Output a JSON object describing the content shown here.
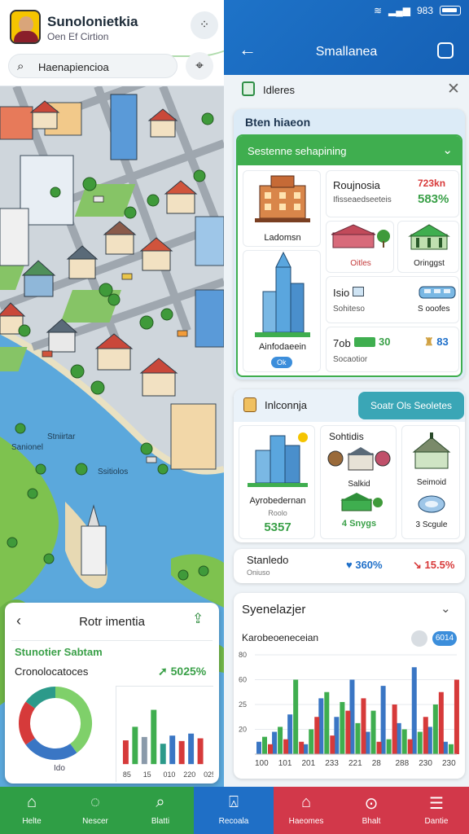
{
  "app": {
    "title": "Sunolonietkia",
    "subtitle": "Oen Ef Cirtion",
    "search_value": "Haenapiencioa"
  },
  "map": {
    "labels": [
      "Sanionel",
      "Stniirtar",
      "Ssitiolos"
    ]
  },
  "map_card": {
    "title": "Rotr imentia",
    "subtitle": "Stunotier Sabtam",
    "metric_label": "Cronolocatoces",
    "metric_value": "5025%",
    "donut_label": "Ido"
  },
  "status_bar": {
    "time": "983"
  },
  "topbar": {
    "title": "Smallanea"
  },
  "info": {
    "title": "Idleres"
  },
  "summary_card": {
    "header": "Bten hiaeon",
    "dropdown": "Sestenne sehapining",
    "tiles": {
      "t1_caption": "Ladomsn",
      "t2_title": "Roujnosia",
      "t2_sub": "Ifisseaedseeteis",
      "t2_val_red": "723kn",
      "t2_val_green": "583%",
      "t3_caption": "Oitles",
      "t4_caption": "Oringgst",
      "t5_caption": "Ainfodaeein",
      "t5_badge": "Ok",
      "t6_title": "Isio",
      "t6_sub": "Sohiteso",
      "t7_caption": "S ooofes",
      "t8_title": "7ob",
      "t8_val_green": "30",
      "t8_sub": "Socaotior",
      "t9_val_blue": "83"
    }
  },
  "info_card": {
    "title": "Inlconnja",
    "pill": "Soatr Ols Seoletes",
    "t1_caption": "Ayrobedernan",
    "t1_sub": "Roolo",
    "t1_value": "5357",
    "t2_title": "Sohtidis",
    "t2_sub": "Salkid",
    "t2_value": "4 Snygs",
    "t3_caption": "Seimoid",
    "t3_sub": "3 Scgule"
  },
  "stat_row": {
    "title": "Stanledo",
    "sub": "Oniuso",
    "up_value": "360%",
    "down_value": "15.5%"
  },
  "chart_card": {
    "title": "Syenelazjer",
    "subtitle": "Karobeoeneceian",
    "badge": "6014"
  },
  "colors": {
    "primary": "#1e73c8",
    "green": "#3fae4f",
    "red": "#d83a3a",
    "teal": "#3aa6b6"
  },
  "nav": [
    {
      "label": "Helte",
      "icon": "home-icon",
      "color": "#2f9e45"
    },
    {
      "label": "Nescer",
      "icon": "chat-icon",
      "color": "#2f9e45"
    },
    {
      "label": "Blatti",
      "icon": "search-icon",
      "color": "#2f9e45"
    },
    {
      "label": "Recoala",
      "icon": "bag-icon",
      "color": "#1f6fc6"
    },
    {
      "label": "Haeomes",
      "icon": "house-icon",
      "color": "#d2384a"
    },
    {
      "label": "Bhalt",
      "icon": "pin-icon",
      "color": "#d2384a"
    },
    {
      "label": "Dantie",
      "icon": "menu-icon",
      "color": "#d2384a"
    }
  ],
  "chart_data": [
    {
      "type": "pie",
      "title": "",
      "slices": [
        {
          "name": "",
          "value": 40,
          "color": "#7fd06a"
        },
        {
          "name": "",
          "value": 25,
          "color": "#3a76c4"
        },
        {
          "name": "",
          "value": 20,
          "color": "#d63a3a"
        },
        {
          "name": "",
          "value": 15,
          "color": "#2c9a8a"
        }
      ]
    },
    {
      "type": "bar",
      "title": "",
      "categories": [
        "85",
        "15",
        "010",
        "220",
        "025"
      ],
      "values": [
        35,
        55,
        40,
        80,
        30,
        42,
        34,
        45,
        38
      ],
      "colors": [
        "#d63a3a",
        "#3fae4f",
        "#8a9aaa",
        "#3fae4f",
        "#2c9a8a",
        "#3a76c4",
        "#d63a3a",
        "#3a76c4",
        "#d63a3a"
      ]
    },
    {
      "type": "bar",
      "title": "",
      "yticks": [
        "20",
        "25",
        "60",
        "80"
      ],
      "categories": [
        "100",
        "101",
        "201",
        "233",
        "221",
        "28",
        "288",
        "230",
        "230"
      ],
      "series": [
        {
          "name": "",
          "color": "#3a76c4",
          "values": [
            10,
            18,
            32,
            8,
            45,
            30,
            60,
            18,
            55,
            25,
            70,
            22,
            10
          ]
        },
        {
          "name": "",
          "color": "#3fae4f",
          "values": [
            14,
            22,
            60,
            20,
            50,
            42,
            25,
            35,
            12,
            20,
            18,
            40,
            8
          ]
        },
        {
          "name": "",
          "color": "#d63a3a",
          "values": [
            8,
            12,
            10,
            30,
            15,
            35,
            45,
            10,
            40,
            12,
            30,
            50,
            60
          ]
        }
      ]
    }
  ]
}
